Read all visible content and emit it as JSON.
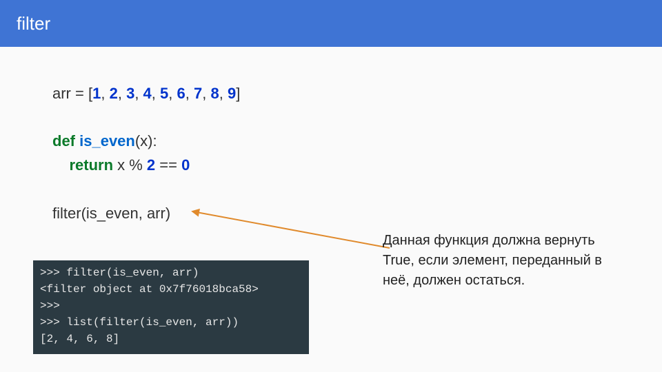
{
  "header": {
    "title": "filter"
  },
  "code": {
    "var": "arr",
    "eq": " = ",
    "lb": "[",
    "rb": "]",
    "nums": [
      "1",
      "2",
      "3",
      "4",
      "5",
      "6",
      "7",
      "8",
      "9"
    ],
    "comma": ", ",
    "def": "def",
    "fname": "is_even",
    "sig": "(x):",
    "indent": "    ",
    "ret": "return",
    "body": " x % ",
    "two": "2",
    "eqeq": " == ",
    "zero": "0",
    "call_fn": "filter",
    "call_args": "(is_even, arr)"
  },
  "terminal": {
    "l1": ">>> filter(is_even, arr)",
    "l2": "<filter object at 0x7f76018bca58>",
    "l3": ">>>",
    "l4": ">>> list(filter(is_even, arr))",
    "l5": "[2, 4, 6, 8]"
  },
  "annotation": {
    "text": "Данная функция должна вернуть True, если элемент, переданный в неё, должен остаться."
  }
}
